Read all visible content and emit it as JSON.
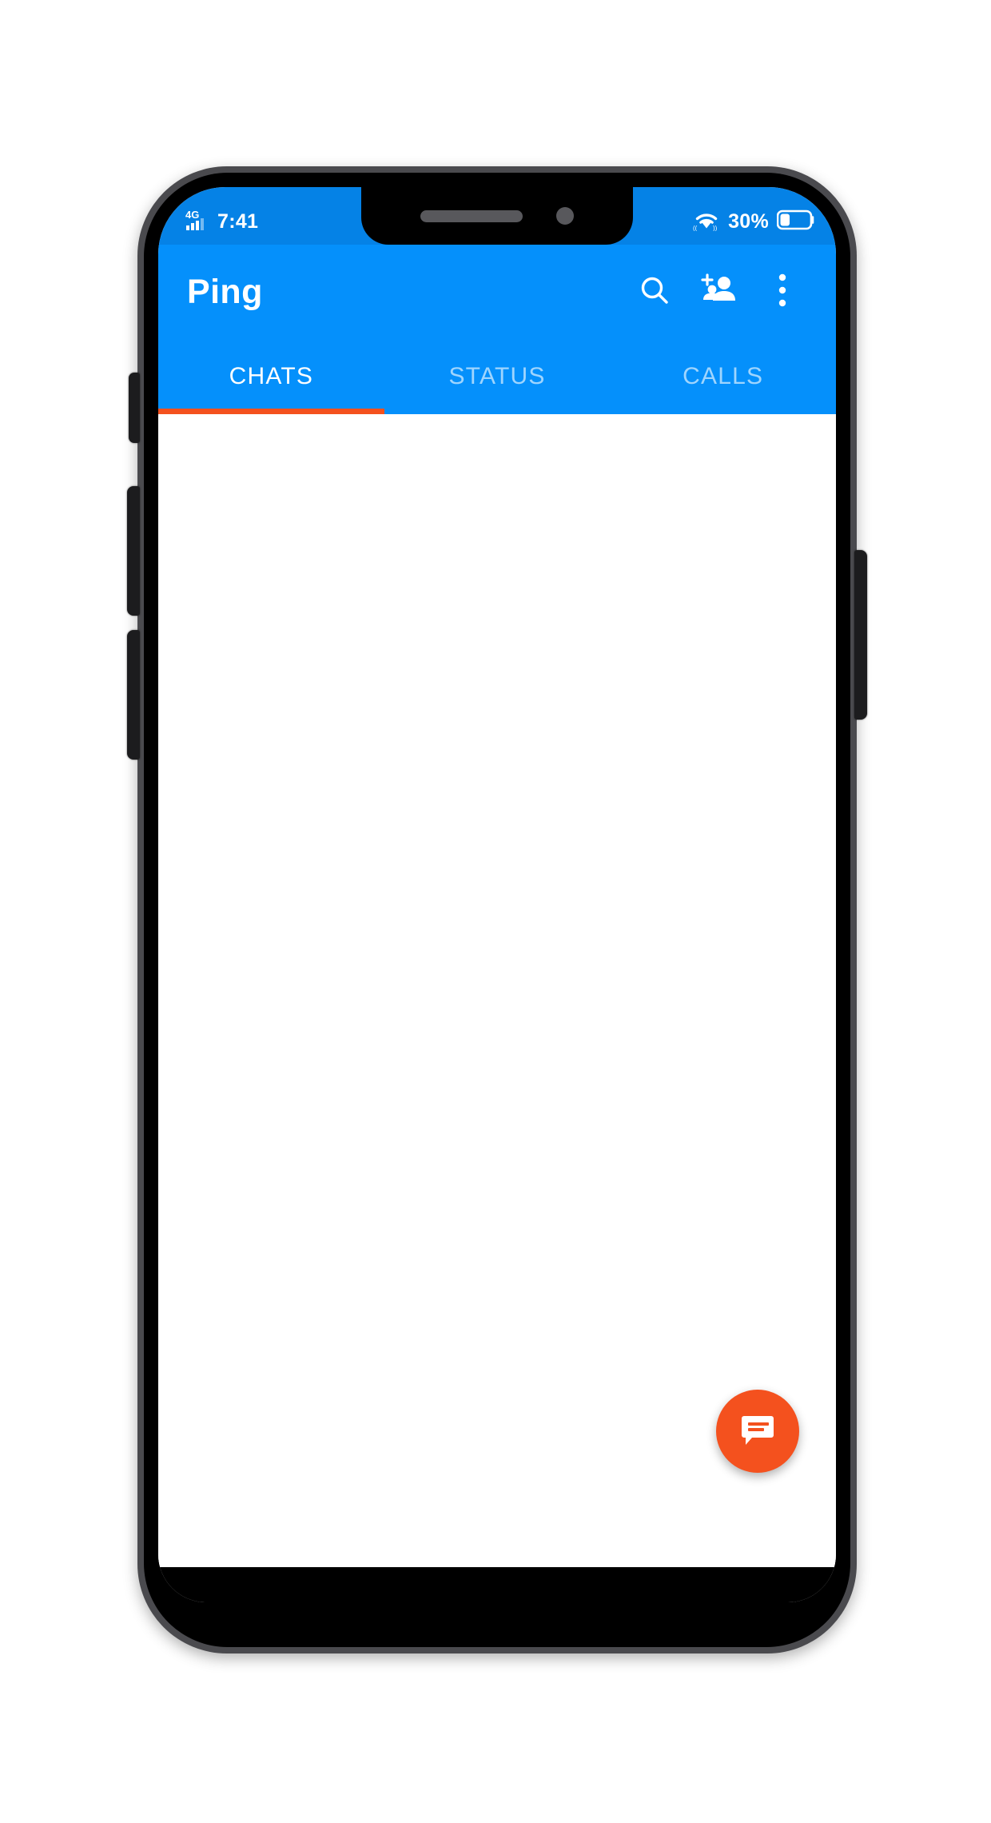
{
  "device": {
    "name": "smartphone-mockup",
    "frame_color": "#4a4a4e",
    "bezel_color": "#000000",
    "buttons": [
      {
        "name": "silent-switch"
      },
      {
        "name": "volume-up-button"
      },
      {
        "name": "volume-down-button"
      },
      {
        "name": "power-button"
      }
    ],
    "notch": {
      "speaker_name": "earpiece-speaker",
      "camera_name": "front-camera"
    }
  },
  "status_bar": {
    "background": "#0582e6",
    "network_type": "4G",
    "signal_icon": "signal-bars-icon",
    "time": "7:41",
    "wifi_icon": "wifi-icon",
    "battery_percent": "30%",
    "battery_level": 30,
    "battery_icon": "battery-icon"
  },
  "app_bar": {
    "background": "#0590fb",
    "title": "Ping",
    "actions": [
      {
        "name": "search-icon",
        "label": "Search"
      },
      {
        "name": "add-person-icon",
        "label": "New group"
      },
      {
        "name": "more-vert-icon",
        "label": "More options"
      }
    ]
  },
  "tabs": {
    "indicator_color": "#f4511e",
    "active_index": 0,
    "items": [
      {
        "label": "CHATS",
        "name": "tab-chats"
      },
      {
        "label": "STATUS",
        "name": "tab-status"
      },
      {
        "label": "CALLS",
        "name": "tab-calls"
      }
    ]
  },
  "content": {
    "list_name": "chat-list",
    "items": [],
    "empty": true
  },
  "fab": {
    "name": "new-chat-fab",
    "icon": "chat-bubble-icon",
    "color": "#f4511e",
    "label": "New chat"
  }
}
